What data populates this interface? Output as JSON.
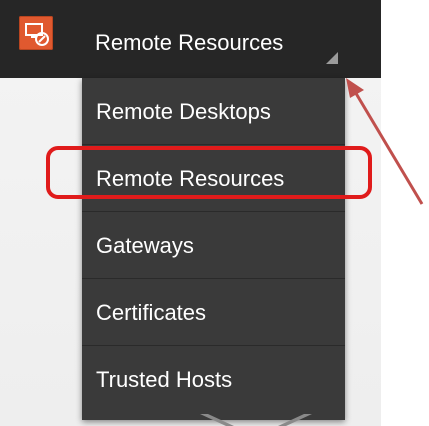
{
  "app": {
    "icon": "remote-desktop-app-icon",
    "title": "Remote Resources"
  },
  "menu": {
    "items": [
      {
        "label": "Remote Desktops"
      },
      {
        "label": "Remote Resources"
      },
      {
        "label": "Gateways"
      },
      {
        "label": "Certificates"
      },
      {
        "label": "Trusted Hosts"
      }
    ]
  },
  "colors": {
    "action_bar": "#262626",
    "menu_bg": "#3a3a3a",
    "app_icon": "#e0592f",
    "annotation": "#e01b1b",
    "arrow": "#c0504d"
  }
}
